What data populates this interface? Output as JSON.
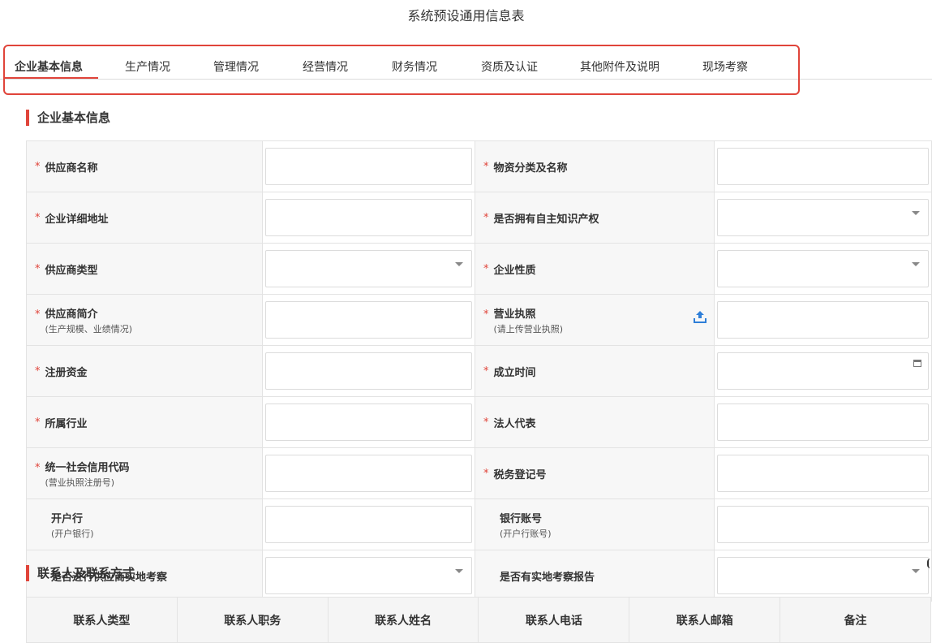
{
  "page": {
    "title": "系统预设通用信息表"
  },
  "tabs": [
    {
      "label": "企业基本信息",
      "active": true
    },
    {
      "label": "生产情况"
    },
    {
      "label": "管理情况"
    },
    {
      "label": "经营情况"
    },
    {
      "label": "财务情况"
    },
    {
      "label": "资质及认证"
    },
    {
      "label": "其他附件及说明"
    },
    {
      "label": "现场考察"
    }
  ],
  "sections": {
    "basic": "企业基本信息",
    "contacts": "联系人及联系方式"
  },
  "form": {
    "required_mark": "*",
    "rows": [
      [
        {
          "label": "供应商名称",
          "required": true,
          "control": "text"
        },
        {
          "label": "物资分类及名称",
          "required": true,
          "control": "text"
        }
      ],
      [
        {
          "label": "企业详细地址",
          "required": true,
          "control": "text"
        },
        {
          "label": "是否拥有自主知识产权",
          "required": true,
          "control": "select"
        }
      ],
      [
        {
          "label": "供应商类型",
          "required": true,
          "control": "select"
        },
        {
          "label": "企业性质",
          "required": true,
          "control": "select"
        }
      ],
      [
        {
          "label": "供应商简介",
          "sub": "(生产规模、业绩情况)",
          "required": true,
          "control": "text"
        },
        {
          "label": "营业执照",
          "sub": "(请上传营业执照)",
          "required": true,
          "control": "text",
          "upload": true
        }
      ],
      [
        {
          "label": "注册资金",
          "required": true,
          "control": "text"
        },
        {
          "label": "成立时间",
          "required": true,
          "control": "date"
        }
      ],
      [
        {
          "label": "所属行业",
          "required": true,
          "control": "text"
        },
        {
          "label": "法人代表",
          "required": true,
          "control": "text"
        }
      ],
      [
        {
          "label": "统一社会信用代码",
          "sub": "(营业执照注册号)",
          "required": true,
          "control": "text"
        },
        {
          "label": "税务登记号",
          "required": true,
          "control": "text"
        }
      ],
      [
        {
          "label": "开户行",
          "sub": "(开户银行)",
          "required": false,
          "control": "text"
        },
        {
          "label": "银行账号",
          "sub": "(开户行账号)",
          "required": false,
          "control": "text"
        }
      ],
      [
        {
          "label": "是否进行供应商实地考察",
          "required": false,
          "control": "select"
        },
        {
          "label": "是否有实地考察报告",
          "required": false,
          "control": "select"
        }
      ]
    ]
  },
  "contacts": {
    "columns": [
      "联系人类型",
      "联系人职务",
      "联系人姓名",
      "联系人电话",
      "联系人邮箱",
      "备注"
    ]
  }
}
